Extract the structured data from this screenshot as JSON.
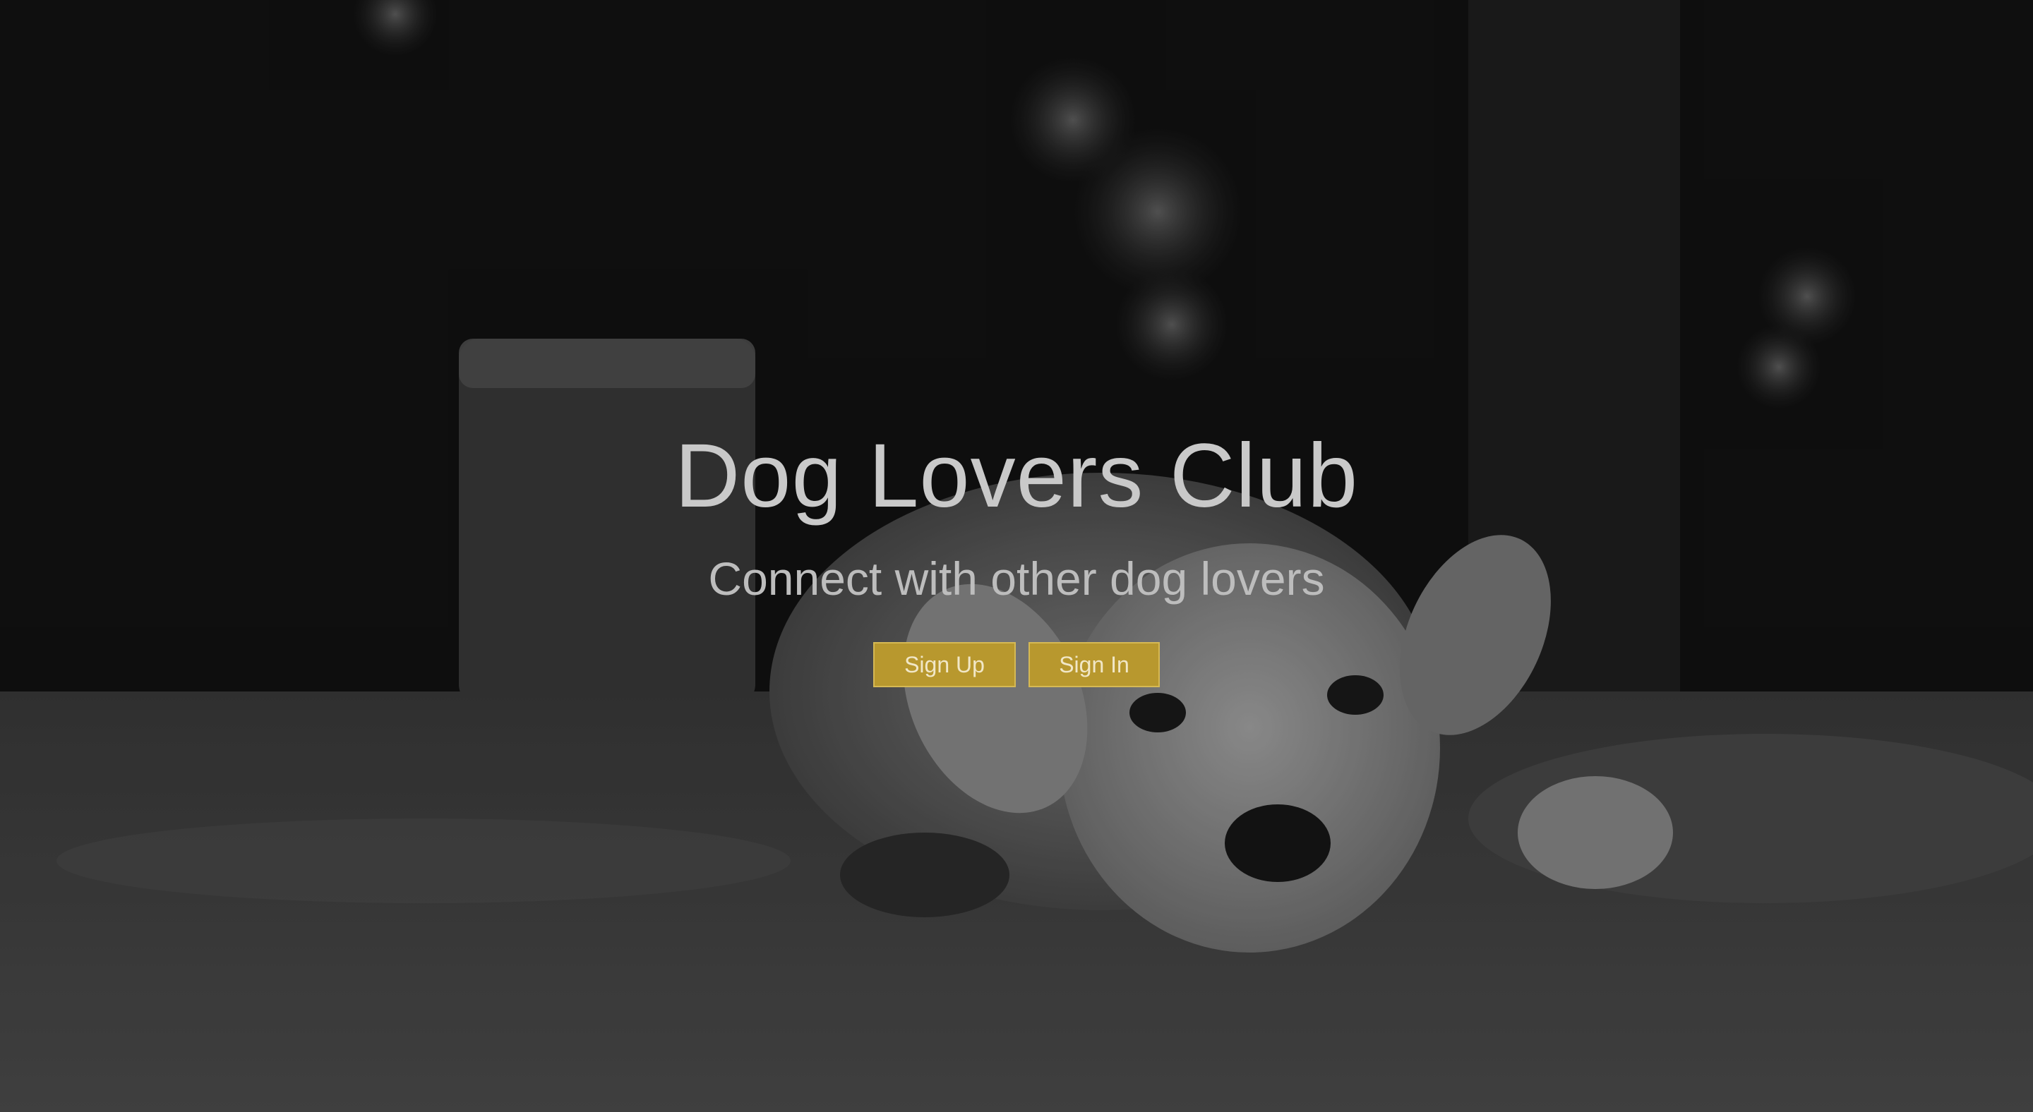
{
  "hero": {
    "title": "Dog Lovers Club",
    "subtitle": "Connect with other dog lovers",
    "background": "black-and-white photo of a dog lying on the ground"
  },
  "buttons": {
    "signup_label": "Sign Up",
    "signin_label": "Sign In"
  },
  "colors": {
    "button_bg": "#b8982e",
    "button_border": "#d6b954",
    "title_text": "#c9c9c9"
  }
}
